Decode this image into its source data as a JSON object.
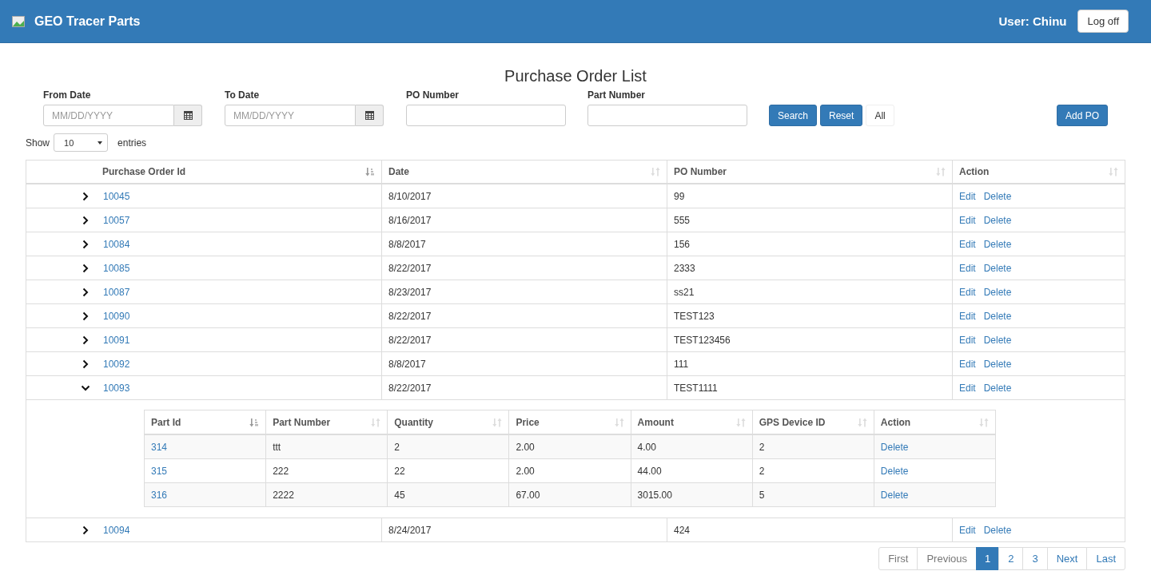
{
  "navbar": {
    "brand": "GEO Tracer Parts",
    "user": "User: Chinu",
    "logoff": "Log off"
  },
  "title": "Purchase Order List",
  "filters": [
    {
      "kind": "date",
      "label": "From Date",
      "placeholder": "MM/DD/YYYY"
    },
    {
      "kind": "date",
      "label": "To Date",
      "placeholder": "MM/DD/YYYY"
    },
    {
      "kind": "text",
      "label": "PO Number"
    },
    {
      "kind": "text",
      "label": "Part Number"
    }
  ],
  "buttons": [
    {
      "label": "Search",
      "kind": "primary"
    },
    {
      "label": "Reset",
      "kind": "primary"
    },
    {
      "label": "All",
      "kind": "default"
    }
  ],
  "add_button": "Add PO",
  "length": {
    "before": "Show",
    "value": "10",
    "after": "entries"
  },
  "table": {
    "columns": [
      {
        "label": "Purchase Order Id",
        "sorted": true
      },
      {
        "label": "Date",
        "sorted": false
      },
      {
        "label": "PO Number",
        "sorted": false
      },
      {
        "label": "Action",
        "sorted": false
      }
    ],
    "rows": [
      {
        "id": "10045",
        "date": "8/10/2017",
        "po": "99",
        "actions": [
          "Edit",
          "Delete"
        ],
        "expanded": false
      },
      {
        "id": "10057",
        "date": "8/16/2017",
        "po": "555",
        "actions": [
          "Edit",
          "Delete"
        ],
        "expanded": false
      },
      {
        "id": "10084",
        "date": "8/8/2017",
        "po": "156",
        "actions": [
          "Edit",
          "Delete"
        ],
        "expanded": false
      },
      {
        "id": "10085",
        "date": "8/22/2017",
        "po": "2333",
        "actions": [
          "Edit",
          "Delete"
        ],
        "expanded": false
      },
      {
        "id": "10087",
        "date": "8/23/2017",
        "po": "ss21",
        "actions": [
          "Edit",
          "Delete"
        ],
        "expanded": false
      },
      {
        "id": "10090",
        "date": "8/22/2017",
        "po": "TEST123",
        "actions": [
          "Edit",
          "Delete"
        ],
        "expanded": false
      },
      {
        "id": "10091",
        "date": "8/22/2017",
        "po": "TEST123456",
        "actions": [
          "Edit",
          "Delete"
        ],
        "expanded": false
      },
      {
        "id": "10092",
        "date": "8/8/2017",
        "po": "111",
        "actions": [
          "Edit",
          "Delete"
        ],
        "expanded": false
      },
      {
        "id": "10093",
        "date": "8/22/2017",
        "po": "TEST1111",
        "actions": [
          "Edit",
          "Delete"
        ],
        "expanded": true,
        "parts": {
          "columns": [
            {
              "label": "Part Id",
              "sorted": true
            },
            {
              "label": "Part Number",
              "sorted": false
            },
            {
              "label": "Quantity",
              "sorted": false
            },
            {
              "label": "Price",
              "sorted": false
            },
            {
              "label": "Amount",
              "sorted": false
            },
            {
              "label": "GPS Device ID",
              "sorted": false
            },
            {
              "label": "Action",
              "sorted": false
            }
          ],
          "rows": [
            {
              "cells": [
                "314",
                "ttt",
                "2",
                "2.00",
                "4.00",
                "2"
              ],
              "action": "Delete"
            },
            {
              "cells": [
                "315",
                "222",
                "22",
                "2.00",
                "44.00",
                "2"
              ],
              "action": "Delete"
            },
            {
              "cells": [
                "316",
                "2222",
                "45",
                "67.00",
                "3015.00",
                "5"
              ],
              "action": "Delete"
            }
          ]
        }
      },
      {
        "id": "10094",
        "date": "8/24/2017",
        "po": "424",
        "actions": [
          "Edit",
          "Delete"
        ],
        "expanded": false
      }
    ]
  },
  "pagination": [
    {
      "label": "First",
      "disabled": true,
      "selected": false
    },
    {
      "label": "Previous",
      "disabled": true,
      "selected": false
    },
    {
      "label": "1",
      "disabled": false,
      "selected": true
    },
    {
      "label": "2",
      "disabled": false,
      "selected": false
    },
    {
      "label": "3",
      "disabled": false,
      "selected": false
    },
    {
      "label": "Next",
      "disabled": false,
      "selected": false
    },
    {
      "label": "Last",
      "disabled": false,
      "selected": false
    }
  ]
}
